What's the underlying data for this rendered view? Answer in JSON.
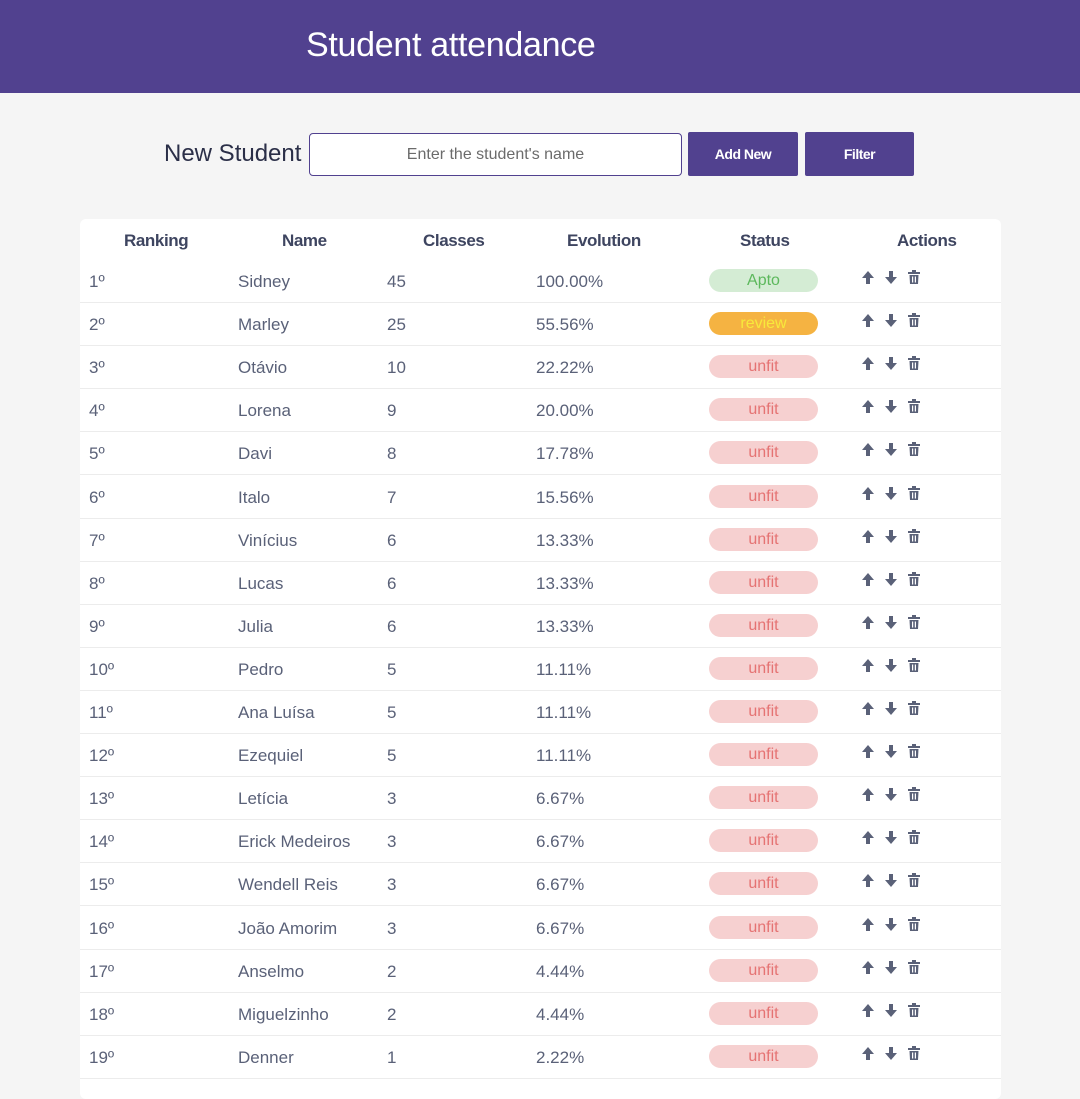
{
  "header": {
    "title": "Student attendance"
  },
  "form": {
    "label": "New Student",
    "input_placeholder": "Enter the student's name",
    "input_value": "",
    "add_button": "Add New",
    "filter_button": "Filter"
  },
  "table": {
    "columns": [
      "Ranking",
      "Name",
      "Classes",
      "Evolution",
      "Status",
      "Actions"
    ],
    "rows": [
      {
        "rank": "1º",
        "name": "Sidney",
        "classes": "45",
        "evolution": "100.00%",
        "status": "Apto"
      },
      {
        "rank": "2º",
        "name": "Marley",
        "classes": "25",
        "evolution": "55.56%",
        "status": "review"
      },
      {
        "rank": "3º",
        "name": "Otávio",
        "classes": "10",
        "evolution": "22.22%",
        "status": "unfit"
      },
      {
        "rank": "4º",
        "name": "Lorena",
        "classes": "9",
        "evolution": "20.00%",
        "status": "unfit"
      },
      {
        "rank": "5º",
        "name": "Davi",
        "classes": "8",
        "evolution": "17.78%",
        "status": "unfit"
      },
      {
        "rank": "6º",
        "name": "Italo",
        "classes": "7",
        "evolution": "15.56%",
        "status": "unfit"
      },
      {
        "rank": "7º",
        "name": "Vinícius",
        "classes": "6",
        "evolution": "13.33%",
        "status": "unfit"
      },
      {
        "rank": "8º",
        "name": "Lucas",
        "classes": "6",
        "evolution": "13.33%",
        "status": "unfit"
      },
      {
        "rank": "9º",
        "name": "Julia",
        "classes": "6",
        "evolution": "13.33%",
        "status": "unfit"
      },
      {
        "rank": "10º",
        "name": "Pedro",
        "classes": "5",
        "evolution": "11.11%",
        "status": "unfit"
      },
      {
        "rank": "11º",
        "name": "Ana Luísa",
        "classes": "5",
        "evolution": "11.11%",
        "status": "unfit"
      },
      {
        "rank": "12º",
        "name": "Ezequiel",
        "classes": "5",
        "evolution": "11.11%",
        "status": "unfit"
      },
      {
        "rank": "13º",
        "name": "Letícia",
        "classes": "3",
        "evolution": "6.67%",
        "status": "unfit"
      },
      {
        "rank": "14º",
        "name": "Erick Medeiros",
        "classes": "3",
        "evolution": "6.67%",
        "status": "unfit"
      },
      {
        "rank": "15º",
        "name": "Wendell Reis",
        "classes": "3",
        "evolution": "6.67%",
        "status": "unfit"
      },
      {
        "rank": "16º",
        "name": "João Amorim",
        "classes": "3",
        "evolution": "6.67%",
        "status": "unfit"
      },
      {
        "rank": "17º",
        "name": "Anselmo",
        "classes": "2",
        "evolution": "4.44%",
        "status": "unfit"
      },
      {
        "rank": "18º",
        "name": "Miguelzinho",
        "classes": "2",
        "evolution": "4.44%",
        "status": "unfit"
      },
      {
        "rank": "19º",
        "name": "Denner",
        "classes": "1",
        "evolution": "2.22%",
        "status": "unfit"
      }
    ]
  },
  "colors": {
    "brand": "#51418f",
    "apto_bg": "#d4ecd4",
    "apto_text": "#5cb85c",
    "review_bg": "#f5b342",
    "review_text": "#f7e93b",
    "unfit_bg": "#f6d0d0",
    "unfit_text": "#e57373",
    "icon": "#5a6178"
  },
  "icons": {
    "up": "arrow-up-icon",
    "down": "arrow-down-icon",
    "delete": "trash-icon"
  }
}
